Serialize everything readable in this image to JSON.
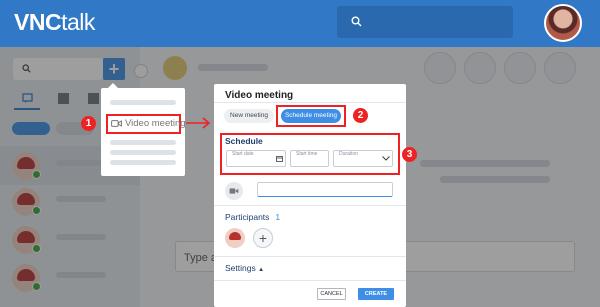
{
  "app": {
    "logo_bold": "VNC",
    "logo_light": "talk"
  },
  "popover": {
    "video_meeting_label": "Video meeting"
  },
  "steps": {
    "one": "1",
    "two": "2",
    "three": "3"
  },
  "modal": {
    "title": "Video meeting",
    "tabs": {
      "new_meeting": "New meeting",
      "schedule_meeting": "Schedule meeting"
    },
    "schedule": {
      "label": "Schedule",
      "start_date_placeholder": "Start date",
      "start_time_placeholder": "Start time",
      "duration_placeholder": "Duration"
    },
    "participants": {
      "label": "Participants",
      "count": "1"
    },
    "settings_label": "Settings",
    "cancel_label": "CANCEL",
    "create_label": "CREATE"
  },
  "chat": {
    "input_placeholder": "Type a"
  },
  "colors": {
    "brand_blue": "#3178c6",
    "accent_blue": "#3e8ee6",
    "highlight_red": "#e22222",
    "online_green": "#3aa53a"
  }
}
